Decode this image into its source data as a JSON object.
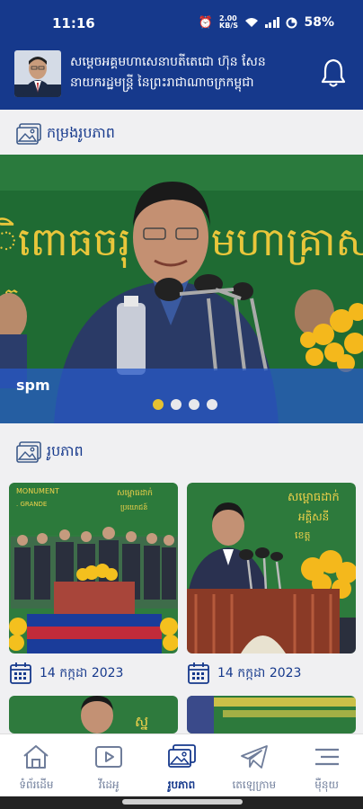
{
  "status_bar": {
    "time": "11:16",
    "network_speed": "2.00\nKB/S",
    "battery": "58%"
  },
  "header": {
    "title_line1": "សម្ដេចអគ្គមហាសេនាបតីតេជោ ហ៊ុន សែន",
    "title_line2": "នាយករដ្ឋមន្ត្រី នៃព្រះរាជាណាចក្រកម្ពុជា",
    "bell_icon": "bell-icon"
  },
  "sections": {
    "banner_title": "កម្រងរូបភាព",
    "gallery_title": "រូបភាព"
  },
  "banner": {
    "caption": "spm",
    "backdrop_text": "ិពោធចរុះ ... មហាគ្រាស",
    "dots_count": 4,
    "active_dot": 0
  },
  "gallery": {
    "items": [
      {
        "date": "14 កក្កដា 2023",
        "photo_text": "MONUMENT"
      },
      {
        "date": "14 កក្កដា 2023",
        "photo_text": "សម្ពោធដាក់"
      }
    ]
  },
  "bottom_nav": [
    {
      "label": "ទំព័រដើម",
      "icon": "home-icon"
    },
    {
      "label": "វីដេអូ",
      "icon": "video-icon"
    },
    {
      "label": "រូបភាព",
      "icon": "image-icon",
      "active": true
    },
    {
      "label": "តេឡេក្រាម",
      "icon": "telegram-icon"
    },
    {
      "label": "ម៉ឺនុយ",
      "icon": "menu-icon"
    }
  ],
  "colors": {
    "brand_blue": "#16398c",
    "active_dot": "#e6c131"
  }
}
